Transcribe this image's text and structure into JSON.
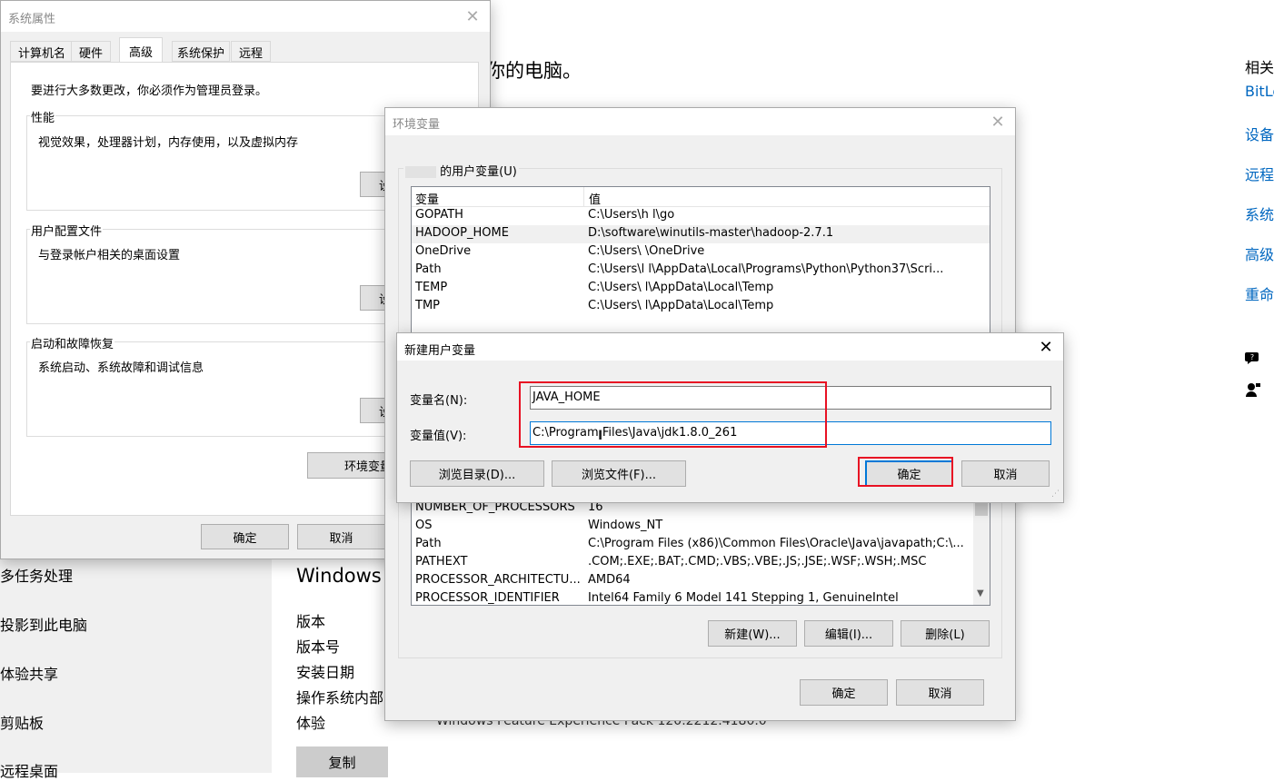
{
  "background": {
    "heading_partial": "你的电脑。",
    "sidebar_items": [
      "多任务处理",
      "投影到此电脑",
      "体验共享",
      "剪贴板",
      "远程桌面"
    ],
    "windows_section": {
      "title": "Windows",
      "spec_labels": [
        "版本",
        "版本号",
        "安装日期",
        "操作系统内部",
        "体验"
      ],
      "experience_value": "Windows Feature Experience Pack 120.2212.4180.0",
      "copy_button": "复制"
    },
    "related": {
      "title": "相关",
      "links": [
        "BitLo",
        "设备",
        "远程",
        "系统",
        "高级",
        "重命"
      ]
    }
  },
  "system_properties": {
    "title": "系统属性",
    "tabs": [
      "计算机名",
      "硬件",
      "高级",
      "系统保护",
      "远程"
    ],
    "active_tab": "高级",
    "admin_note": "要进行大多数更改，你必须作为管理员登录。",
    "performance": {
      "label": "性能",
      "desc": "视觉效果，处理器计划，内存使用，以及虚拟内存",
      "button": "设"
    },
    "user_profiles": {
      "label": "用户配置文件",
      "desc": "与登录帐户相关的桌面设置",
      "button": "设"
    },
    "startup_recovery": {
      "label": "启动和故障恢复",
      "desc": "系统启动、系统故障和调试信息",
      "button": "设"
    },
    "env_button": "环境变量",
    "ok": "确定",
    "cancel": "取消"
  },
  "env_vars": {
    "title": "环境变量",
    "user_section_label": "的用户变量(U)",
    "columns": [
      "变量",
      "值"
    ],
    "user_vars": [
      {
        "name": "GOPATH",
        "value": "C:\\Users\\h       l\\go"
      },
      {
        "name": "HADOOP_HOME",
        "value": "D:\\software\\winutils-master\\hadoop-2.7.1"
      },
      {
        "name": "OneDrive",
        "value": "C:\\Users\\        \\OneDrive"
      },
      {
        "name": "Path",
        "value": "C:\\Users\\l       l\\AppData\\Local\\Programs\\Python\\Python37\\Scri..."
      },
      {
        "name": "TEMP",
        "value": "C:\\Users\\        l\\AppData\\Local\\Temp"
      },
      {
        "name": "TMP",
        "value": "C:\\Users\\        l\\AppData\\Local\\Temp"
      }
    ],
    "system_vars": [
      {
        "name": "NUMBER_OF_PROCESSORS",
        "value": "16"
      },
      {
        "name": "OS",
        "value": "Windows_NT"
      },
      {
        "name": "Path",
        "value": "C:\\Program Files (x86)\\Common Files\\Oracle\\Java\\javapath;C:\\..."
      },
      {
        "name": "PATHEXT",
        "value": ".COM;.EXE;.BAT;.CMD;.VBS;.VBE;.JS;.JSE;.WSF;.WSH;.MSC"
      },
      {
        "name": "PROCESSOR_ARCHITECTU...",
        "value": "AMD64"
      },
      {
        "name": "PROCESSOR_IDENTIFIER",
        "value": "Intel64 Family 6 Model 141 Stepping 1, GenuineIntel"
      }
    ],
    "new_button": "新建(W)...",
    "edit_button": "编辑(I)...",
    "delete_button": "删除(L)",
    "ok": "确定",
    "cancel": "取消"
  },
  "new_var_dialog": {
    "title": "新建用户变量",
    "name_label": "变量名(N):",
    "name_value": "JAVA_HOME",
    "value_label": "变量值(V):",
    "value_value": "C:\\Program Files\\Java\\jdk1.8.0_261",
    "browse_dir": "浏览目录(D)...",
    "browse_file": "浏览文件(F)...",
    "ok": "确定",
    "cancel": "取消"
  },
  "colors": {
    "highlight": "#e81123",
    "link": "#0067c0"
  }
}
